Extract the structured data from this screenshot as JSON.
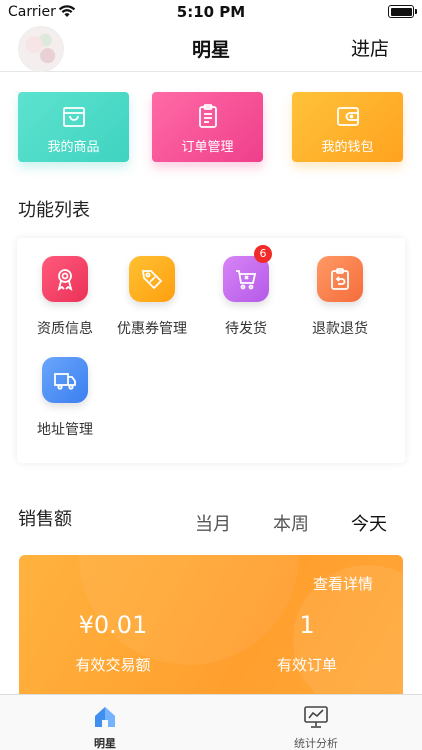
{
  "status_bar": {
    "carrier": "Carrier",
    "time": "5:10 PM"
  },
  "nav": {
    "title": "明星",
    "right_action": "进店"
  },
  "quick_cards": [
    {
      "label": "我的商品",
      "icon": "shopping-bag-icon",
      "color": "#4fdcc8"
    },
    {
      "label": "订单管理",
      "icon": "clipboard-list-icon",
      "color": "#f5559a"
    },
    {
      "label": "我的钱包",
      "icon": "wallet-icon",
      "color": "#ffae2b"
    }
  ],
  "function_section": {
    "title": "功能列表",
    "items": [
      {
        "label": "资质信息",
        "icon": "award-icon",
        "color": "#f2426a"
      },
      {
        "label": "优惠券管理",
        "icon": "coupon-tag-icon",
        "color": "#ffab1a"
      },
      {
        "label": "待发货",
        "icon": "cart-icon",
        "color": "#c56df2",
        "badge": "6"
      },
      {
        "label": "退款退货",
        "icon": "return-icon",
        "color": "#ff8451"
      },
      {
        "label": "地址管理",
        "icon": "truck-icon",
        "color": "#4d8ff4"
      }
    ]
  },
  "sales": {
    "title": "销售额",
    "tabs": [
      "当月",
      "本周",
      "今天"
    ],
    "active_tab": "今天",
    "details_link": "查看详情",
    "amount_value": "¥0.01",
    "amount_label": "有效交易额",
    "orders_value": "1",
    "orders_label": "有效订单"
  },
  "tab_bar": {
    "items": [
      {
        "label": "明星",
        "icon": "home-icon",
        "active": true
      },
      {
        "label": "统计分析",
        "icon": "monitor-chart-icon",
        "active": false
      }
    ]
  },
  "colors": {
    "accent_home": "#3f8ff0",
    "sales_card": "#ffa734"
  }
}
